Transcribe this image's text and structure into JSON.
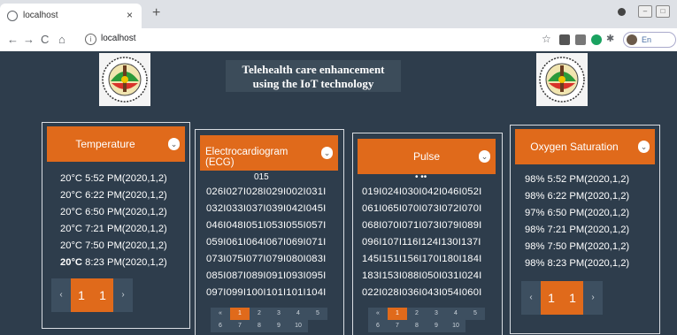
{
  "browser": {
    "tab_title": "localhost",
    "tab_close": "×",
    "new_tab": "+",
    "url": "localhost",
    "pause_label": "En pause",
    "min_btn": "–",
    "max_btn": "□"
  },
  "header": {
    "title_line1": "Telehealth care enhancement",
    "title_line2": "using the IoT technology"
  },
  "temperature": {
    "title": "Temperature",
    "rows": [
      "20°C 5:52 PM(2020,1,2)",
      "20°C 6:22 PM(2020,1,2)",
      "20°C 6:50 PM(2020,1,2)",
      "20°C 7:21 PM(2020,1,2)",
      "20°C 7:50 PM(2020,1,2)"
    ],
    "last_bold": "20°C",
    "last_rest": " 8:23 PM(2020,1,2)",
    "pager": {
      "prev": "‹",
      "a": "1",
      "b": "1",
      "next": "›"
    }
  },
  "ecg": {
    "title": "Electrocardiogram (ECG)",
    "cut_text": "015",
    "rows": [
      "026I027I028I029I002I031I",
      "032I033I037I039I042I045I",
      "046I048I051I053I055I057I",
      "059I061I064I067I069I071I",
      "073I075I077I079I080I083I",
      "085I087I089I091I093I095I",
      "097I099I100I101I101I104I"
    ],
    "pager": {
      "row1": [
        "«",
        "1",
        "2",
        "3",
        "4",
        "5"
      ],
      "row2": [
        "6",
        "7",
        "8",
        "9",
        "10"
      ]
    }
  },
  "pulse": {
    "title": "Pulse",
    "cut_text": "• ••",
    "rows": [
      "019I024I030I042I046I052I",
      "061I065I070I073I072I070I",
      "068I070I071I073I079I089I",
      "096I107I116I124I130I137I",
      "145I151I156I170I180I184I",
      "183I153I088I050I031I024I",
      "022I028I036I043I054I060I"
    ],
    "pager": {
      "row1": [
        "«",
        "1",
        "2",
        "3",
        "4",
        "5"
      ],
      "row2": [
        "6",
        "7",
        "8",
        "9",
        "10"
      ]
    }
  },
  "oxygen": {
    "title": "Oxygen Saturation",
    "rows": [
      "98% 5:52 PM(2020,1,2)",
      "98% 6:22 PM(2020,1,2)",
      "97% 6:50 PM(2020,1,2)",
      "98% 7:21 PM(2020,1,2)",
      "98% 7:50 PM(2020,1,2)",
      "98% 8:23 PM(2020,1,2)"
    ],
    "pager": {
      "prev": "‹",
      "a": "1",
      "b": "1",
      "next": "›"
    }
  },
  "colors": {
    "accent": "#e06a1b",
    "background": "#2e3d4c",
    "pager_bg": "#3d4f60"
  }
}
